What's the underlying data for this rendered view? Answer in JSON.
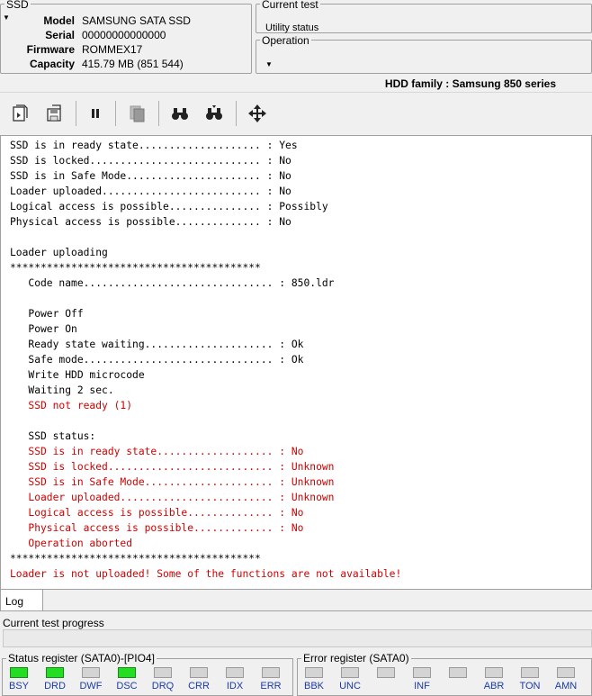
{
  "ssd": {
    "title": "SSD",
    "fields": [
      {
        "label": "Model",
        "value": "SAMSUNG SATA SSD"
      },
      {
        "label": "Serial",
        "value": "00000000000000"
      },
      {
        "label": "Firmware",
        "value": "ROMMEX17"
      },
      {
        "label": "Capacity",
        "value": "415.79 MB (851 544)"
      }
    ]
  },
  "current_test": {
    "title": "Current test",
    "value": "Utility status"
  },
  "operation": {
    "title": "Operation",
    "value": ""
  },
  "hdd_family": "HDD family : Samsung 850 series",
  "toolbar": {
    "icons": [
      "load-icon",
      "save-icon",
      "pause-icon",
      "copy-icon",
      "find-icon",
      "find-next-icon",
      "move-icon"
    ]
  },
  "log_lines": [
    {
      "text": "SSD is in ready state.................... : Yes",
      "red": false
    },
    {
      "text": "SSD is locked............................ : No",
      "red": false
    },
    {
      "text": "SSD is in Safe Mode...................... : No",
      "red": false
    },
    {
      "text": "Loader uploaded.......................... : No",
      "red": false
    },
    {
      "text": "Logical access is possible............... : Possibly",
      "red": false
    },
    {
      "text": "Physical access is possible.............. : No",
      "red": false
    },
    {
      "text": "",
      "red": false
    },
    {
      "text": "Loader uploading",
      "red": false
    },
    {
      "text": "*****************************************",
      "red": false
    },
    {
      "text": "   Code name............................... : 850.ldr",
      "red": false
    },
    {
      "text": "",
      "red": false
    },
    {
      "text": "   Power Off",
      "red": false
    },
    {
      "text": "   Power On",
      "red": false
    },
    {
      "text": "   Ready state waiting..................... : Ok",
      "red": false
    },
    {
      "text": "   Safe mode............................... : Ok",
      "red": false
    },
    {
      "text": "   Write HDD microcode",
      "red": false
    },
    {
      "text": "   Waiting 2 sec.",
      "red": false
    },
    {
      "text": "   SSD not ready (1)",
      "red": true
    },
    {
      "text": "",
      "red": false
    },
    {
      "text": "   SSD status:",
      "red": false
    },
    {
      "text": "   SSD is in ready state................... : No",
      "red": true
    },
    {
      "text": "   SSD is locked........................... : Unknown",
      "red": true
    },
    {
      "text": "   SSD is in Safe Mode..................... : Unknown",
      "red": true
    },
    {
      "text": "   Loader uploaded......................... : Unknown",
      "red": true
    },
    {
      "text": "   Logical access is possible.............. : No",
      "red": true
    },
    {
      "text": "   Physical access is possible............. : No",
      "red": true
    },
    {
      "text": "   Operation aborted",
      "red": true
    },
    {
      "text": "*****************************************",
      "red": false
    },
    {
      "text": "Loader is not uploaded! Some of the functions are not available!",
      "red": true
    }
  ],
  "tabs": [
    {
      "label": "Log"
    }
  ],
  "progress": {
    "label": "Current test progress",
    "value": 0
  },
  "status_register": {
    "title": "Status register (SATA0)-[PIO4]",
    "flags": [
      {
        "name": "BSY",
        "on": true
      },
      {
        "name": "DRD",
        "on": true
      },
      {
        "name": "DWF",
        "on": false
      },
      {
        "name": "DSC",
        "on": true
      },
      {
        "name": "DRQ",
        "on": false
      },
      {
        "name": "CRR",
        "on": false
      },
      {
        "name": "IDX",
        "on": false
      },
      {
        "name": "ERR",
        "on": false
      }
    ]
  },
  "error_register": {
    "title": "Error register (SATA0)",
    "flags": [
      {
        "name": "BBK",
        "on": false
      },
      {
        "name": "UNC",
        "on": false
      },
      {
        "name": "",
        "on": false
      },
      {
        "name": "INF",
        "on": false
      },
      {
        "name": "",
        "on": false
      },
      {
        "name": "ABR",
        "on": false
      },
      {
        "name": "TON",
        "on": false
      },
      {
        "name": "AMN",
        "on": false
      }
    ]
  },
  "colors": {
    "led_on": "#22dd22",
    "log_error": "#d00000",
    "flag_label": "#1a3aa8"
  }
}
